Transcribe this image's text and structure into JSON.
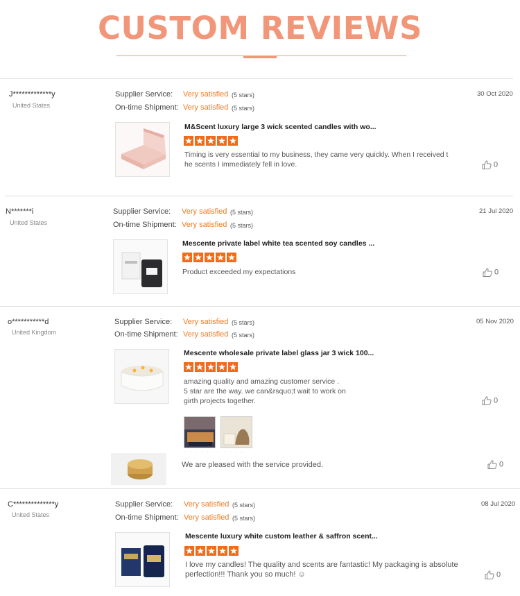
{
  "header": {
    "title": "CUSTOM REVIEWS"
  },
  "labels": {
    "supplier_service": "Supplier Service:",
    "ontime_shipment": "On-time Shipment:"
  },
  "colors": {
    "accent": "#f2967a",
    "orange": "#f07a22",
    "divider": "#dcdcdc"
  },
  "reviews": [
    {
      "user": "J*************y",
      "country": "United States",
      "date": "30 Oct 2020",
      "supplier_value": "Very satisfied",
      "supplier_stars": "(5 stars)",
      "shipment_value": "Very satisfied",
      "shipment_stars": "(5 stars)",
      "product_name": "M&Scent luxury large 3 wick scented candles with wo...",
      "rating": 5,
      "text": "Timing is very essential to my business, they came very quickly. When I received t he scents I immediately fell in love.",
      "likes": "0"
    },
    {
      "user": "N*******i",
      "country": "United States",
      "date": "21 Jul 2020",
      "supplier_value": "Very satisfied",
      "supplier_stars": "(5 stars)",
      "shipment_value": "Very satisfied",
      "shipment_stars": "(5 stars)",
      "product_name": "Mescente private label white tea scented soy candles ...",
      "rating": 5,
      "text": "Product exceeded my expectations",
      "likes": "0"
    },
    {
      "user": "o***********d",
      "country": "United Kingdom",
      "date": "05 Nov 2020",
      "supplier_value": "Very satisfied",
      "supplier_stars": "(5 stars)",
      "shipment_value": "Very satisfied",
      "shipment_stars": "(5 stars)",
      "product_name": "Mescente wholesale private label glass jar 3 wick 100...",
      "rating": 5,
      "text_line1": "amazing quality and amazing customer service .",
      "text_line2": "5 star are the way. we can&rsquo;t wait to work on",
      "text_line3": "girth projects together.",
      "likes": "0",
      "photos_dots": "· · · · · · · · · · ·",
      "extra_text": "We are pleased with the service provided.",
      "extra_likes": "0"
    },
    {
      "user": "C**************y",
      "country": "United States",
      "date": "08 Jul 2020",
      "supplier_value": "Very satisfied",
      "supplier_stars": "(5 stars)",
      "shipment_value": "Very satisfied",
      "shipment_stars": "(5 stars)",
      "product_name": "Mescente luxury white custom leather & saffron scent...",
      "rating": 5,
      "text_line1": "I love my candles! The quality and scents are fantastic! My packaging is absolute",
      "text_line2": "perfection!!! Thank you so much! ☺",
      "likes": "0"
    }
  ]
}
